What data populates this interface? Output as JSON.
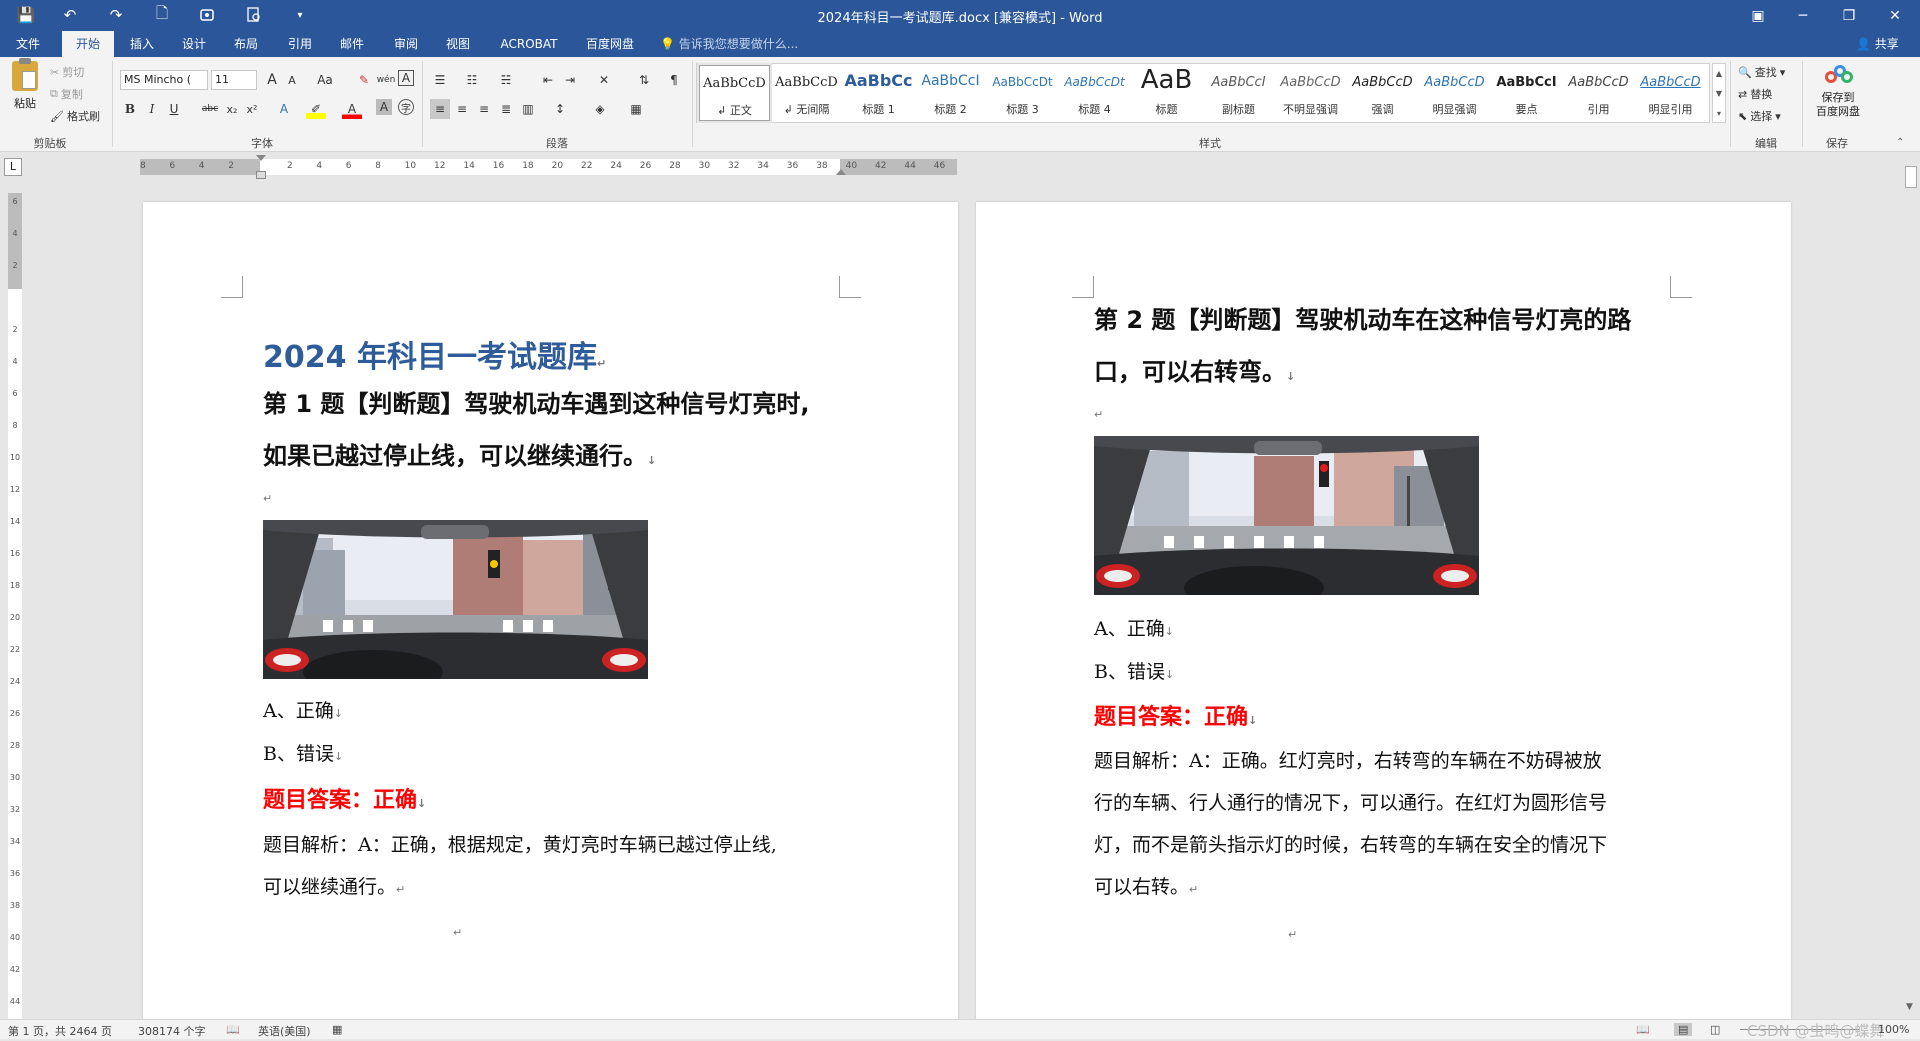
{
  "window": {
    "title": "2024年科目一考试题库.docx [兼容模式] - Word",
    "minimize": "─",
    "restore": "❐",
    "close": "✕",
    "ribbon_display": "▣"
  },
  "qat": {
    "save": "💾",
    "undo": "↶",
    "redo": "↷",
    "new": "🗋",
    "more": "▾"
  },
  "tabs": [
    "文件",
    "开始",
    "插入",
    "设计",
    "布局",
    "引用",
    "邮件",
    "审阅",
    "视图",
    "ACROBAT",
    "百度网盘"
  ],
  "tell_me": "告诉我您想要做什么...",
  "share": "共享",
  "clipboard": {
    "paste": "粘贴",
    "cut": "剪切",
    "copy": "复制",
    "format_painter": "格式刷",
    "label": "剪贴板"
  },
  "font": {
    "name": "MS Mincho (",
    "size": "11",
    "label": "字体",
    "bold": "B",
    "italic": "I",
    "underline": "U",
    "strike": "abc",
    "sub": "x₂",
    "sup": "x²",
    "grow": "A",
    "shrink": "A",
    "case": "Aa"
  },
  "paragraph": {
    "label": "段落"
  },
  "styles": {
    "label": "样式",
    "items": [
      {
        "preview": "AaBbCcD",
        "name": "↲ 正文",
        "color": "#000"
      },
      {
        "preview": "AaBbCcD",
        "name": "↲ 无间隔",
        "color": "#000"
      },
      {
        "preview": "AaBbCc",
        "name": "标题 1",
        "color": "#2e5b9a"
      },
      {
        "preview": "AaBbCcI",
        "name": "标题 2",
        "color": "#2e74b5"
      },
      {
        "preview": "AaBbCcDt",
        "name": "标题 3",
        "color": "#2e74b5"
      },
      {
        "preview": "AaBbCcDt",
        "name": "标题 4",
        "color": "#2e74b5"
      },
      {
        "preview": "AaB",
        "name": "标题",
        "color": "#222"
      },
      {
        "preview": "AaBbCcI",
        "name": "副标题",
        "color": "#5a5a5a"
      },
      {
        "preview": "AaBbCcD",
        "name": "不明显强调",
        "color": "#666"
      },
      {
        "preview": "AaBbCcD",
        "name": "强调",
        "color": "#222"
      },
      {
        "preview": "AaBbCcD",
        "name": "明显强调",
        "color": "#2e74b5"
      },
      {
        "preview": "AaBbCcI",
        "name": "要点",
        "color": "#000"
      },
      {
        "preview": "AaBbCcD",
        "name": "引用",
        "color": "#444"
      },
      {
        "preview": "AaBbCcD",
        "name": "明显引用",
        "color": "#2e74b5"
      }
    ]
  },
  "editing": {
    "find": "查找",
    "replace": "替换",
    "select": "选择",
    "label": "编辑"
  },
  "save_group": {
    "button": "保存到\n百度网盘",
    "line1": "保存到",
    "line2": "百度网盘",
    "label": "保存"
  },
  "ruler": {
    "ticks": [
      "8",
      "6",
      "4",
      "2",
      "",
      "2",
      "4",
      "6",
      "8",
      "10",
      "12",
      "14",
      "16",
      "18",
      "20",
      "22",
      "24",
      "26",
      "28",
      "30",
      "32",
      "34",
      "36",
      "38",
      "40",
      "42",
      "44",
      "46"
    ],
    "vticks": [
      "6",
      "4",
      "2",
      "",
      "2",
      "4",
      "6",
      "8",
      "10",
      "12",
      "14",
      "16",
      "18",
      "20",
      "22",
      "24",
      "26",
      "28",
      "30",
      "32",
      "34",
      "36",
      "38",
      "40",
      "42",
      "44"
    ]
  },
  "page1": {
    "title": "2024 年科目一考试题库",
    "q1_line1": "第 1 题【判断题】驾驶机动车遇到这种信号灯亮时,",
    "q1_line2": "如果已越过停止线，可以继续通行。",
    "opt_a": "A、正确",
    "opt_b": "B、错误",
    "answer": "题目答案：正确",
    "exp_line1": "题目解析：A：正确，根据规定，黄灯亮时车辆已越过停止线,",
    "exp_line2": "可以继续通行。",
    "para_mark": "↵",
    "arrow_mark": "↓"
  },
  "page2": {
    "q2_line1": "第 2 题【判断题】驾驶机动车在这种信号灯亮的路",
    "q2_line2": "口，可以右转弯。",
    "opt_a": "A、正确",
    "opt_b": "B、错误",
    "answer": "题目答案：正确",
    "exp_line1": "题目解析：A：正确。红灯亮时，右转弯的车辆在不妨碍被放",
    "exp_line2": "行的车辆、行人通行的情况下，可以通行。在红灯为圆形信号",
    "exp_line3": "灯，而不是箭头指示灯的时候，右转弯的车辆在安全的情况下",
    "exp_line4": "可以右转。",
    "para_mark": "↵",
    "arrow_mark": "↓"
  },
  "status": {
    "page": "第 1 页，共 2464 页",
    "words": "308174 个字",
    "lang": "英语(美国)",
    "zoom": "100%",
    "watermark": "CSDN @虫鸣@蝶舞"
  }
}
